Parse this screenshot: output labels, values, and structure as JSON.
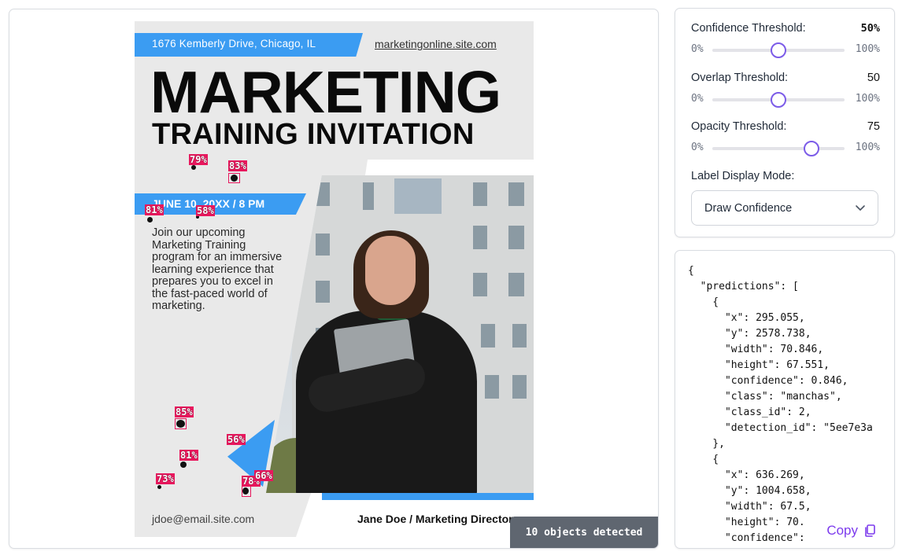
{
  "poster": {
    "address": "1676 Kemberly Drive, Chicago, IL",
    "website": "marketingonline.site.com",
    "title_line1": "MARKETING",
    "title_line2": "TRAINING INVITATION",
    "date": "JUNE 10, 20XX / 8 PM",
    "body": "Join our upcoming Marketing Training program for an immersive learning experience that prepares you to excel in the fast-paced world of marketing.",
    "email": "jdoe@email.site.com",
    "director": "Jane Doe / Marketing Director"
  },
  "detections": [
    {
      "label": "79%"
    },
    {
      "label": "83%"
    },
    {
      "label": "81%"
    },
    {
      "label": "58%"
    },
    {
      "label": "85%"
    },
    {
      "label": "56%"
    },
    {
      "label": "81%"
    },
    {
      "label": "73%"
    },
    {
      "label": "78%"
    },
    {
      "label": "66%"
    }
  ],
  "detected_badge": "10 objects detected",
  "settings": {
    "confidence": {
      "label": "Confidence Threshold:",
      "value": "50%",
      "value_num": 50,
      "min": "0%",
      "max": "100%"
    },
    "overlap": {
      "label": "Overlap Threshold:",
      "value": "50",
      "value_num": 50,
      "min": "0%",
      "max": "100%"
    },
    "opacity": {
      "label": "Opacity Threshold:",
      "value": "75",
      "value_num": 75,
      "min": "0%",
      "max": "100%"
    },
    "label_mode": {
      "label": "Label Display Mode:",
      "selected": "Draw Confidence"
    }
  },
  "json_text": "{\n  \"predictions\": [\n    {\n      \"x\": 295.055,\n      \"y\": 2578.738,\n      \"width\": 70.846,\n      \"height\": 67.551,\n      \"confidence\": 0.846,\n      \"class\": \"manchas\",\n      \"class_id\": 2,\n      \"detection_id\": \"5ee7e3a\n    },\n    {\n      \"x\": 636.269,\n      \"y\": 1004.658,\n      \"width\": 67.5,\n      \"height\": 70.\n      \"confidence\":",
  "copy_label": "Copy",
  "icons": {
    "copy": "copy-icon",
    "chevron": "chevron-down-icon"
  },
  "colors": {
    "accent": "#7c5ce8",
    "detection": "#e8175d",
    "poster_blue": "#3b9cf2",
    "badge": "#5f6670"
  }
}
